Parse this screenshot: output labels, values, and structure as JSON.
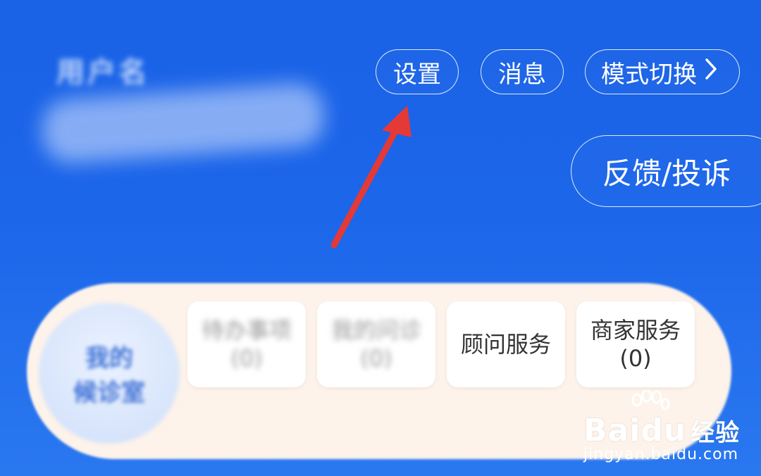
{
  "header": {
    "user_name": "用户名",
    "settings_label": "设置",
    "messages_label": "消息",
    "mode_switch_label": "模式切换",
    "feedback_label": "反馈/投诉"
  },
  "panel": {
    "circle_line1": "我的",
    "circle_line2": "候诊室",
    "cards": [
      {
        "title": "待办事项",
        "sub": "(0)"
      },
      {
        "title": "我的问诊",
        "sub": "(0)"
      },
      {
        "title": "顾问服务",
        "sub": ""
      },
      {
        "title": "商家服务",
        "sub": "(0)"
      }
    ]
  },
  "watermark": {
    "brand": "Baidu",
    "brand_cn": "经验",
    "site": "jingyan.baidu.com"
  },
  "colors": {
    "background": "#1c66ea",
    "arrow": "#e53935",
    "panel": "#fdf3ea"
  }
}
